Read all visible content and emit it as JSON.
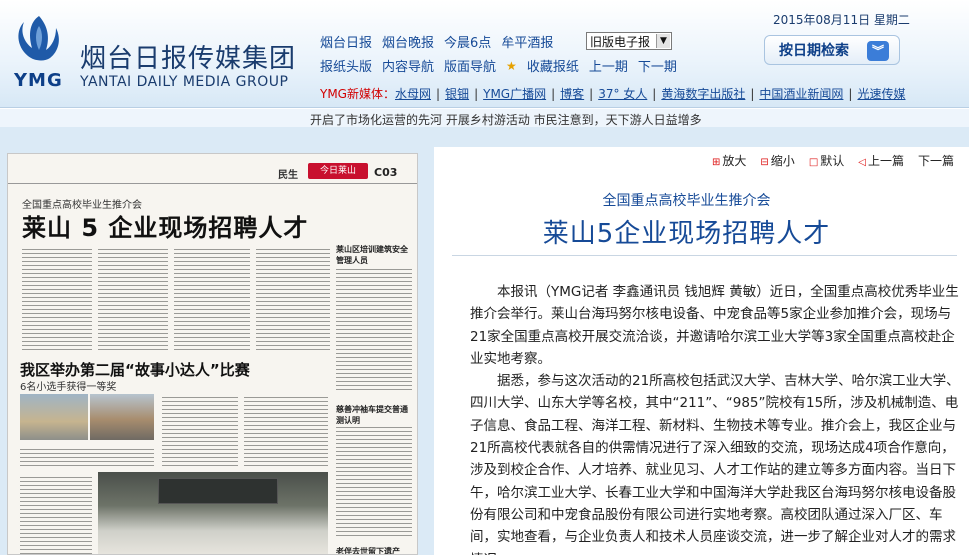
{
  "header": {
    "logo_cn": "烟台日报传媒集团",
    "logo_en": "YANTAI DAILY MEDIA GROUP",
    "logo_abbr": "YMG",
    "date": "2015年08月11日  星期二",
    "nav_row1": [
      "烟台日报",
      "烟台晚报",
      "今晨6点",
      "牟平酒报"
    ],
    "old_paper_select": "旧版电子报",
    "nav_row2": [
      "报纸头版",
      "内容导航",
      "版面导航",
      "收藏报纸",
      "上一期",
      "下一期"
    ],
    "search_label": "按日期检索",
    "links_prefix": "YMG新媒体：",
    "links": [
      "水母网",
      "银钿",
      "YMG广播网",
      "博客",
      "37° 女人",
      "黄海数字出版社",
      "中国酒业新闻网",
      "光速传媒"
    ],
    "brand_red": "#d20000",
    "link_blue": "#164a97"
  },
  "ticker": {
    "text": "开启了市场化运营的先河   开展乡村游活动   市民注意到，天下游人日益增多"
  },
  "paper": {
    "section": "民生",
    "tag": "今日莱山",
    "page_no": "C03",
    "small_head": "全国重点高校毕业生推介会",
    "title": "莱山 5 企业现场招聘人才",
    "headline2": "我区举办第二届“故事小达人”比赛",
    "headline2_sub": "6名小选手获得一等奖",
    "side1": "莱山区培训建筑安全管理人员",
    "side2": "慈善冲袖车提交普通测认明",
    "side3": "老伴去世留下遗产"
  },
  "article": {
    "tools": [
      {
        "icon": "plus-icon",
        "glyph": "⊞",
        "label": "放大"
      },
      {
        "icon": "minus-icon",
        "glyph": "⊟",
        "label": "缩小"
      },
      {
        "icon": "square-icon",
        "glyph": "□",
        "label": "默认"
      },
      {
        "icon": "prev-icon",
        "glyph": "◁",
        "label": "上一篇"
      },
      {
        "icon": "next-icon",
        "glyph": "",
        "label": "下一篇"
      }
    ],
    "kicker": "全国重点高校毕业生推介会",
    "headline": "莱山5企业现场招聘人才",
    "paragraphs": [
      "本报讯（YMG记者 李鑫通讯员 钱旭辉 黄敏）近日，全国重点高校优秀毕业生推介会举行。莱山台海玛努尔核电设备、中宠食品等5家企业参加推介会，现场与21家全国重点高校开展交流洽谈，并邀请哈尔滨工业大学等3家全国重点高校赴企业实地考察。",
      "据悉，参与这次活动的21所高校包括武汉大学、吉林大学、哈尔滨工业大学、四川大学、山东大学等名校，其中“211”、“985”院校有15所，涉及机械制造、电子信息、食品工程、海洋工程、新材料、生物技术等专业。推介会上，我区企业与21所高校代表就各自的供需情况进行了深入细致的交流，现场达成4项合作意向，涉及到校企合作、人才培养、就业见习、人才工作站的建立等多方面内容。当日下午，哈尔滨工业大学、长春工业大学和中国海洋大学赴我区台海玛努尔核电设备股份有限公司和中宠食品股份有限公司进行实地考察。高校团队通过深入厂区、车间，实地查看，与企业负责人和技术人员座谈交流，进一步了解企业对人才的需求情况。"
    ]
  }
}
